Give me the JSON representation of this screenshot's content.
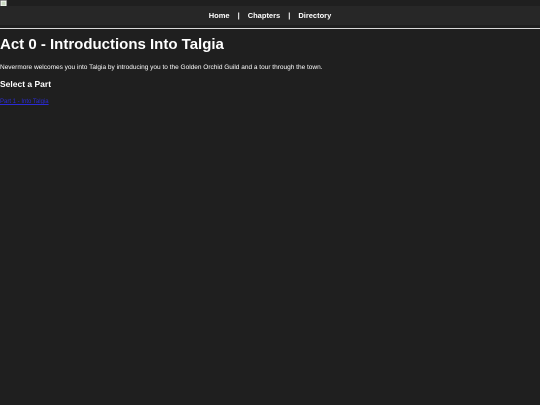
{
  "nav": {
    "items": [
      {
        "label": "Home"
      },
      {
        "label": "Chapters"
      },
      {
        "label": "Directory"
      }
    ],
    "separator": "|"
  },
  "main": {
    "title": "Act 0 - Introductions Into Talgia",
    "description": "Nevermore welcomes you into Talgia by introducing you to the Golden Orchid Guild and a tour through the town.",
    "section_heading": "Select a Part",
    "parts": [
      {
        "label": "Part 1 - Into Talgia"
      }
    ]
  },
  "colors": {
    "background": "#1f1f1f",
    "navbar": "#272727",
    "text": "#ffffff",
    "link": "#2b2bd6",
    "divider": "#d8d8d8"
  },
  "icons": {
    "broken_image": "broken-image-icon"
  }
}
